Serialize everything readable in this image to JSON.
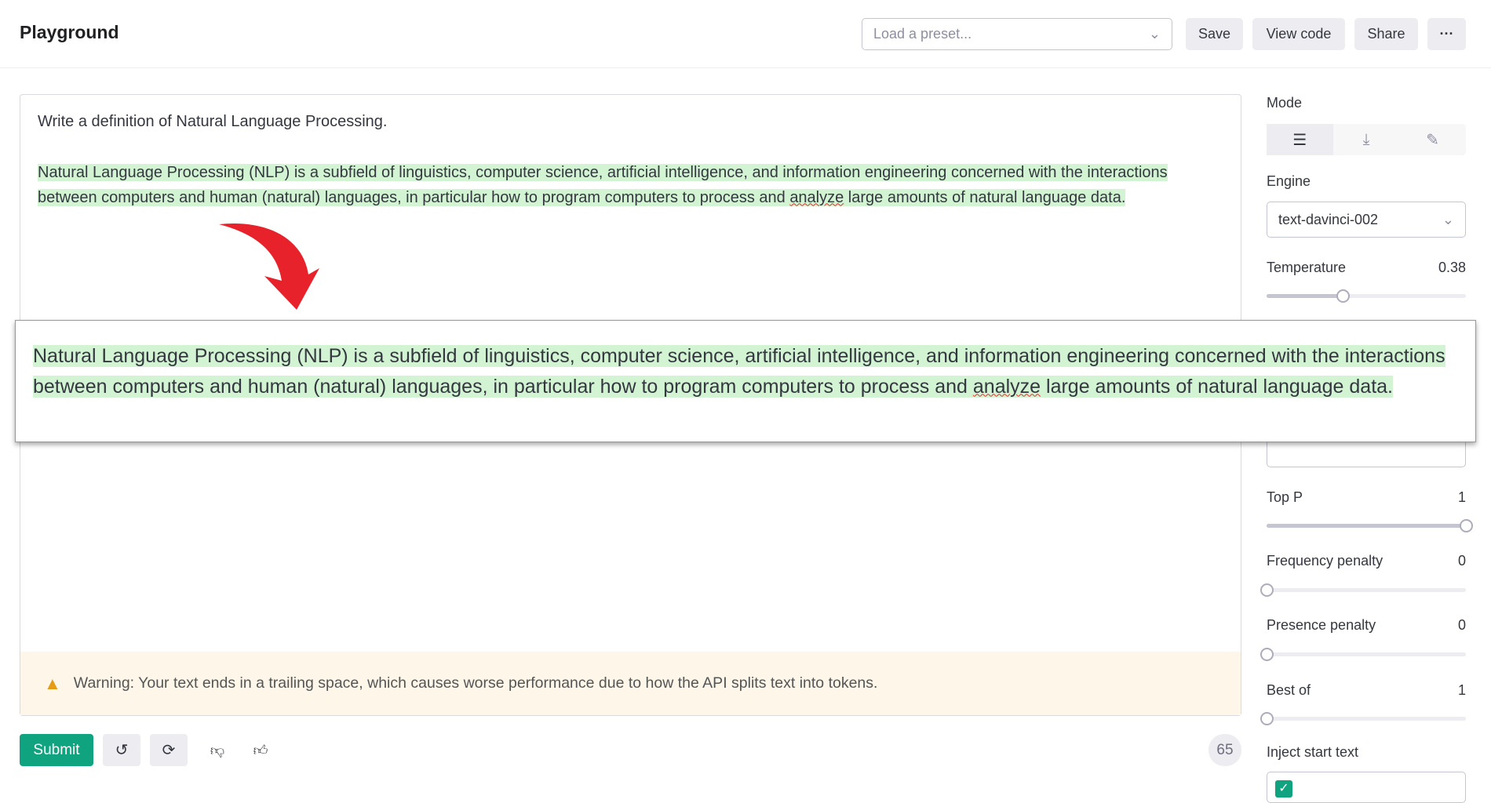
{
  "header": {
    "title": "Playground",
    "preset_placeholder": "Load a preset...",
    "save": "Save",
    "view_code": "View code",
    "share": "Share",
    "more": "···"
  },
  "editor": {
    "prompt": "Write a definition of Natural Language Processing.",
    "completion_a": "Natural Language Processing (NLP) is a subfield of linguistics, computer science, artificial intelligence, and information engineering concerned with the interactions between computers and human (natural) languages, in particular how to program computers to process and ",
    "completion_misspelled": "analyze",
    "completion_b": " large amounts of natural language data.",
    "warning": "Warning: Your text ends in a trailing space, which causes worse performance due to how the API splits text into tokens."
  },
  "callout": {
    "text_a": "Natural Language Processing (NLP) is a subfield of linguistics, computer science, artificial intelligence, and information engineering concerned with the interactions between computers and human (natural) languages, in particular how to program computers to process and ",
    "misspelled": "analyze",
    "text_b": " large amounts of natural language data."
  },
  "footer": {
    "submit": "Submit",
    "token_count": "65"
  },
  "sidebar": {
    "mode_label": "Mode",
    "engine_label": "Engine",
    "engine_value": "text-davinci-002",
    "temperature": {
      "label": "Temperature",
      "value": "0.38",
      "fraction": 0.38
    },
    "top_p": {
      "label": "Top P",
      "value": "1",
      "fraction": 1
    },
    "frequency_penalty": {
      "label": "Frequency penalty",
      "value": "0",
      "fraction": 0
    },
    "presence_penalty": {
      "label": "Presence penalty",
      "value": "0",
      "fraction": 0
    },
    "best_of": {
      "label": "Best of",
      "value": "1",
      "fraction": 0
    },
    "inject_label": "Inject start text",
    "inject_checked": true
  },
  "colors": {
    "accent": "#10a37f",
    "highlight": "#d2f4d3",
    "warning_bg": "#fdf6e9",
    "arrow": "#e8222a"
  }
}
